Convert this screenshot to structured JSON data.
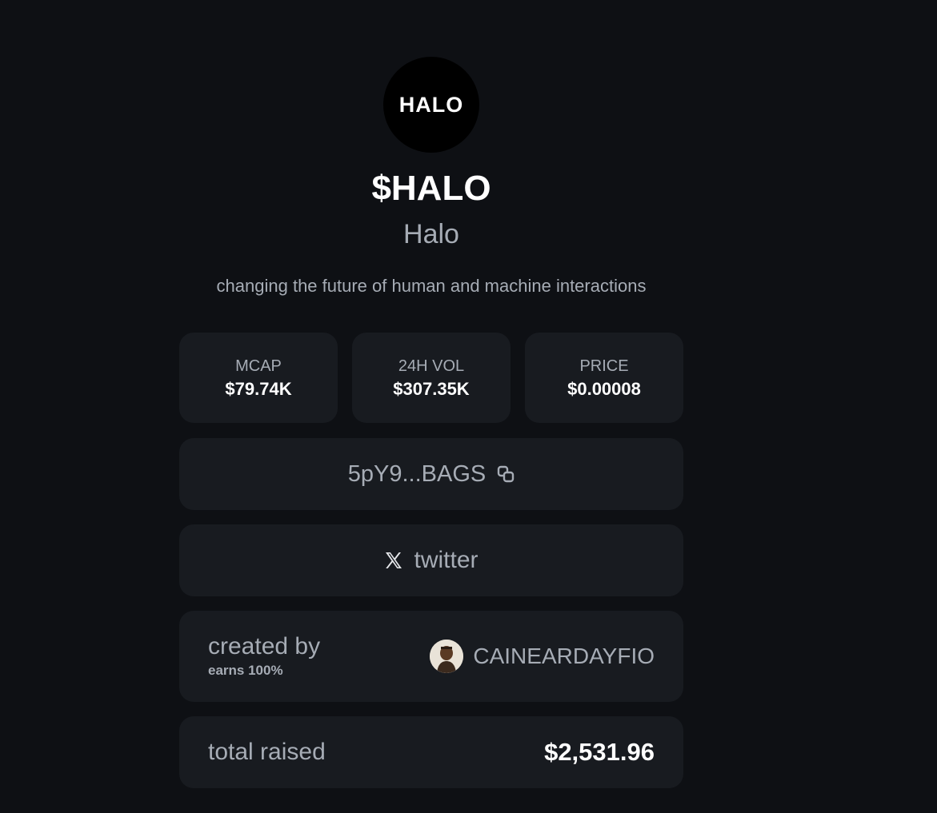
{
  "token": {
    "logo_text": "HALO",
    "ticker": "$HALO",
    "name": "Halo",
    "description": "changing the future of human and machine interactions"
  },
  "stats": [
    {
      "label": "MCAP",
      "value": "$79.74K"
    },
    {
      "label": "24H VOL",
      "value": "$307.35K"
    },
    {
      "label": "PRICE",
      "value": "$0.00008"
    }
  ],
  "address": {
    "short": "5pY9...BAGS",
    "icon": "copy-icon"
  },
  "social": {
    "label": "twitter",
    "icon": "x-icon"
  },
  "creator": {
    "label": "created by",
    "earns": "earns 100%",
    "username": "CAINEARDAYFIO"
  },
  "raised": {
    "label": "total raised",
    "value": "$2,531.96"
  },
  "colors": {
    "background": "#0e1014",
    "card": "#181b20",
    "muted_text": "#a6acb5",
    "primary_text": "#ffffff"
  }
}
